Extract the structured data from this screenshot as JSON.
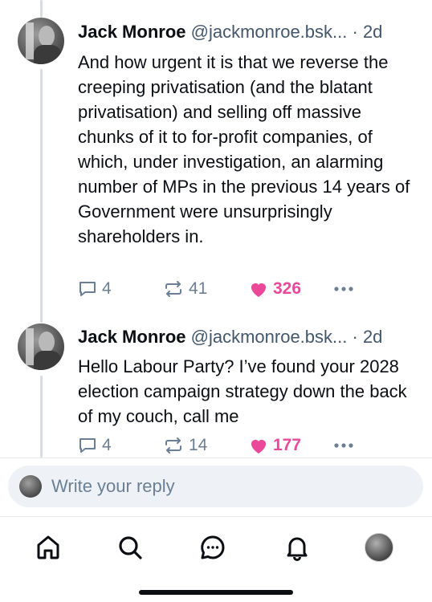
{
  "posts": [
    {
      "author_name": "Jack Monroe",
      "handle": "@jackmonroe.bsk...",
      "separator": "·",
      "time": "2d",
      "text": "And how urgent it is that we reverse the creeping privatisation (and the blatant privatisation) and selling off massive chunks of it to for-profit companies, of which, under investigation, an alarming number of MPs in the previous 14 years of Government were unsurprisingly shareholders in.",
      "replies": "4",
      "reposts": "41",
      "likes": "326",
      "liked": true
    },
    {
      "author_name": "Jack Monroe",
      "handle": "@jackmonroe.bsk...",
      "separator": "·",
      "time": "2d",
      "text": "Hello Labour Party? I’ve found your 2028 election campaign strategy down the back of my couch, call me",
      "replies": "4",
      "reposts": "14",
      "likes": "177",
      "liked": true
    }
  ],
  "composer": {
    "placeholder": "Write your reply"
  },
  "tabbar": {
    "items": [
      "home-icon",
      "search-icon",
      "chat-icon",
      "notifications-bell-icon",
      "profile-avatar"
    ]
  },
  "colors": {
    "like": "#ec4899",
    "muted": "#6b7f94",
    "text": "#0b0f14"
  }
}
